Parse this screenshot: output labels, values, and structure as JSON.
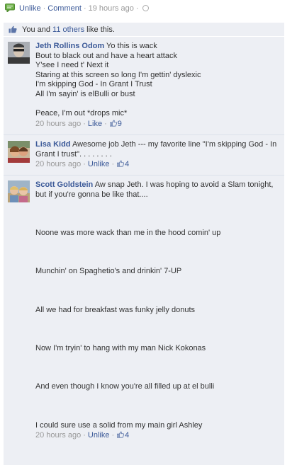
{
  "top_actions": {
    "unlike": "Unlike",
    "comment": "Comment",
    "time": "19 hours ago"
  },
  "likes": {
    "prefix": "You and ",
    "others_link": "11 others",
    "suffix": " like this."
  },
  "comments": [
    {
      "author": "Jeth Rollins Odom",
      "first_line": " Yo this is wack",
      "body": "Bout to black out and have a heart attack\nY'see I need t' Next it\nStaring at this screen so long I'm gettin' dyslexic\nI'm skipping God - In Grant I Trust\nAll I'm sayin' is elBulli or bust\n\nPeace, I'm out *drops mic*",
      "time": "20 hours ago",
      "action": "Like",
      "likes": "9"
    },
    {
      "author": "Lisa Kidd",
      "first_line": " Awesome job Jeth --- my favorite line \"I'm skipping God - In Grant I trust\". . . . . . . .",
      "body": "",
      "time": "20 hours ago",
      "action": "Unlike",
      "likes": "4"
    },
    {
      "author": "Scott Goldstein",
      "first_line": " Aw snap Jeth. I was hoping to avoid a Slam tonight, but if you're gonna be like that....",
      "body": "\n\n\nNoone was more wack than me in the hood comin' up\n\n\n\nMunchin' on Spaghetio's and drinkin' 7-UP\n\n\n\nAll we had for breakfast was funky jelly donuts\n\n\n\nNow I'm tryin' to hang with my man Nick Kokonas\n\n\n\nAnd even though I know you're all filled up at el bulli\n\n\n\nI could sure use a solid from my main girl Ashley",
      "time": "20 hours ago",
      "action": "Unlike",
      "likes": "4"
    }
  ],
  "icons": {
    "comment": "speech-bubble-icon",
    "privacy": "globe-icon",
    "like": "thumbs-up-icon"
  },
  "colors": {
    "link": "#3b5998",
    "panel_bg": "#edeff4",
    "meta_text": "#999999"
  }
}
